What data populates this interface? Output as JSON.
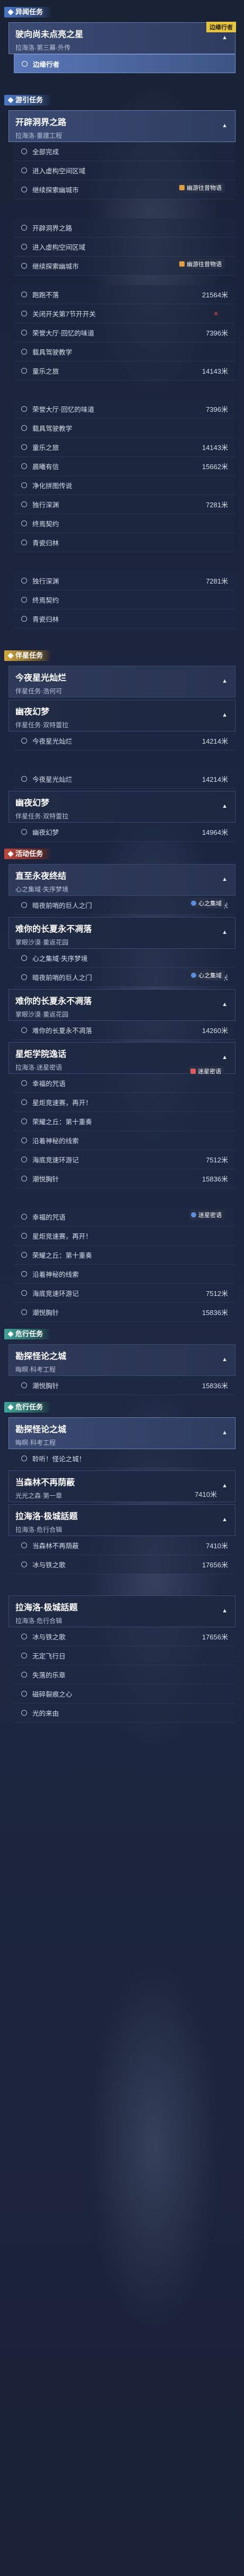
{
  "sections": {
    "s1": "异闻任务",
    "s2": "游引任务",
    "s3": "伴星任务",
    "s4": "活动任务",
    "s5": "危行任务",
    "s6": "危行任务"
  },
  "mission1": {
    "title": "驶向尚未点亮之星",
    "sub": "拉海洛·第三幕·外传",
    "tag": "边缘行者",
    "item": "边缘行者"
  },
  "mission2": {
    "title": "开辟洞界之路",
    "sub": "拉海洛·重建工程",
    "items": [
      "全部完成",
      "进入虚构空间区域",
      "继续探索幽城市"
    ],
    "badge": "幽游往昔物语"
  },
  "block3": {
    "items": [
      "开辟洞界之路",
      "进入虚构空间区域",
      "继续探索幽城市"
    ],
    "badge": "幽游往昔物语"
  },
  "list4": [
    {
      "label": "跑跑不落",
      "val": "21564米"
    },
    {
      "label": "关闭开关第7节开开关",
      "x": "✕"
    },
    {
      "label": "荣誉大厅·回忆的味道",
      "val": "7396米"
    },
    {
      "label": "载具驾驶教学"
    },
    {
      "label": "童乐之旅",
      "val": "14143米"
    }
  ],
  "list5": [
    {
      "label": "荣誉大厅·回忆的味道",
      "val": "7396米"
    },
    {
      "label": "载具驾驶教学"
    },
    {
      "label": "童乐之旅",
      "val": "14143米"
    },
    {
      "label": "晨曦有信",
      "val": "15662米"
    },
    {
      "label": "净化拼图传说"
    },
    {
      "label": "独行深渊",
      "val": "7281米"
    },
    {
      "label": "终焉契约"
    },
    {
      "label": "青瓷归林"
    }
  ],
  "list6": [
    {
      "label": "独行深渊",
      "val": "7281米"
    },
    {
      "label": "终焉契约"
    },
    {
      "label": "青瓷归林"
    }
  ],
  "mission7": {
    "title": "今夜星光灿烂",
    "sub": "伴星任务·浩何可"
  },
  "mission8": {
    "title": "幽夜幻梦",
    "sub": "伴星任务·双特蕾拉"
  },
  "list8": [
    {
      "label": "今夜星光灿烂",
      "val": "14214米"
    }
  ],
  "list9": [
    {
      "label": "今夜星光灿烂",
      "val": "14214米"
    }
  ],
  "mission9": {
    "title": "幽夜幻梦",
    "sub": "伴星任务·双特蕾拉"
  },
  "list9b": [
    {
      "label": "幽夜幻梦",
      "val": "14964米"
    }
  ],
  "mission10": {
    "title": "直至永夜终结",
    "sub": "心之集域·失序梦境"
  },
  "list10": [
    {
      "label": "暗夜前哨的巨人之门",
      "val": "9064米",
      "badge": "心之集域"
    }
  ],
  "mission11": {
    "title": "难你的长夏永不凋落",
    "sub": "掌眼沙漠·重返花园"
  },
  "list11": [
    {
      "label": "心之集域·失序梦境"
    },
    {
      "label": "暗夜前哨的巨人之门",
      "val": "9064米",
      "badge": "心之集域"
    }
  ],
  "mission12": {
    "title": "难你的长夏永不凋落",
    "sub": "掌眼沙漠·重返花园"
  },
  "list12": [
    {
      "label": "难你的长夏永不凋落",
      "val": "14260米"
    }
  ],
  "mission13": {
    "title": "星炬学院逸话",
    "sub": "拉海洛·迷星密语",
    "badge": "迷星密语"
  },
  "list13": [
    {
      "label": "幸福的咒语"
    },
    {
      "label": "星炬竞速赛，再开！"
    },
    {
      "label": "荣耀之丘：第十重奏"
    },
    {
      "label": "沿着神秘的线索"
    },
    {
      "label": "海底竞速环游记",
      "val": "7512米"
    },
    {
      "label": "潮悦胸针",
      "val": "15836米"
    }
  ],
  "list14": [
    {
      "label": "幸福的咒语",
      "badge": "迷星密语"
    },
    {
      "label": "星炬竞速赛，再开！"
    },
    {
      "label": "荣耀之丘：第十重奏"
    },
    {
      "label": "沿着神秘的线索"
    },
    {
      "label": "海底竞速环游记",
      "val": "7512米"
    },
    {
      "label": "潮悦胸针",
      "val": "15836米"
    }
  ],
  "mission15": {
    "title": "勘探怪论之城",
    "sub": "晦暝·科考工程"
  },
  "list15": [
    {
      "label": "潮悦胸针",
      "val": "15836米"
    }
  ],
  "mission16": {
    "title": "勘探怪论之城",
    "sub": "晦暝·科考工程"
  },
  "list16": [
    {
      "label": "聆听！怪论之城！"
    }
  ],
  "mission17": {
    "title": "当森林不再荫蔽",
    "sub": "光光之森·第一章",
    "val": "7410米"
  },
  "mission18": {
    "title": "拉海洛·极城話题",
    "sub": "拉海洛·危行合辑"
  },
  "list18": [
    {
      "label": "当森林不再荫蔽",
      "val": "7410米"
    },
    {
      "label": "冰与铁之歌",
      "val": "17656米"
    }
  ],
  "mission19": {
    "title": "拉海洛·极城話题",
    "sub": "拉海洛·危行合辑"
  },
  "list19": [
    {
      "label": "冰与铁之歌",
      "val": "17656米"
    },
    {
      "label": "无定飞行日"
    },
    {
      "label": "失落的乐章"
    },
    {
      "label": "磁碎裂痕之心"
    },
    {
      "label": "光的来由"
    }
  ],
  "colors": {
    "accent": "#5a78b8",
    "corner": "#e8c43a",
    "danger": "#d84c4c"
  }
}
